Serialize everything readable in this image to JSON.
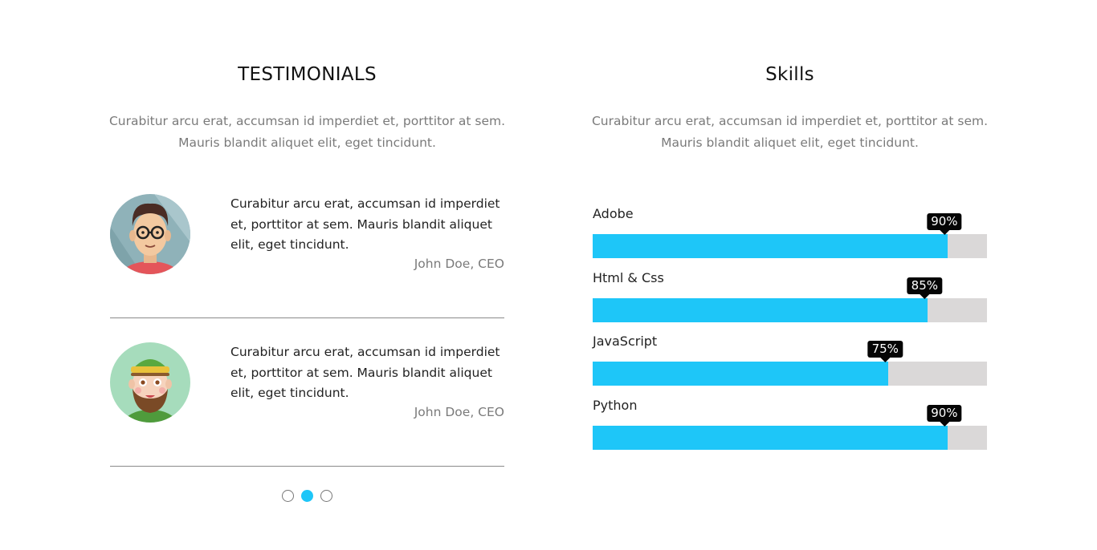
{
  "testimonials": {
    "title": "TESTIMONIALS",
    "intro_line1": "Curabitur arcu erat, accumsan id imperdiet et, porttitor at sem.",
    "intro_line2": "Mauris blandit aliquet elit, eget tincidunt.",
    "items": [
      {
        "quote": "Curabitur arcu erat, accumsan id imperdiet et, porttitor at sem. Mauris blandit aliquet elit, eget tincidunt.",
        "author": "John Doe, CEO",
        "avatar_icon": "man-with-glasses-avatar"
      },
      {
        "quote": "Curabitur arcu erat, accumsan id imperdiet et, porttitor at sem. Mauris blandit aliquet elit, eget tincidunt.",
        "author": "John Doe, CEO",
        "avatar_icon": "bearded-man-with-cap-avatar"
      }
    ],
    "pagination": {
      "total": 3,
      "active": 2
    }
  },
  "skills": {
    "title": "Skills",
    "intro_line1": "Curabitur arcu erat, accumsan id imperdiet et, porttitor at sem.",
    "intro_line2": "Mauris blandit aliquet elit, eget tincidunt.",
    "items": [
      {
        "name": "Adobe",
        "percent": 90,
        "label": "90%"
      },
      {
        "name": "Html & Css",
        "percent": 85,
        "label": "85%"
      },
      {
        "name": "JavaScript",
        "percent": 75,
        "label": "75%"
      },
      {
        "name": "Python",
        "percent": 90,
        "label": "90%"
      }
    ]
  },
  "colors": {
    "accent": "#1ec6f8",
    "track": "#dad8d8",
    "badge": "#050505",
    "muted_text": "#7a7a7a"
  }
}
